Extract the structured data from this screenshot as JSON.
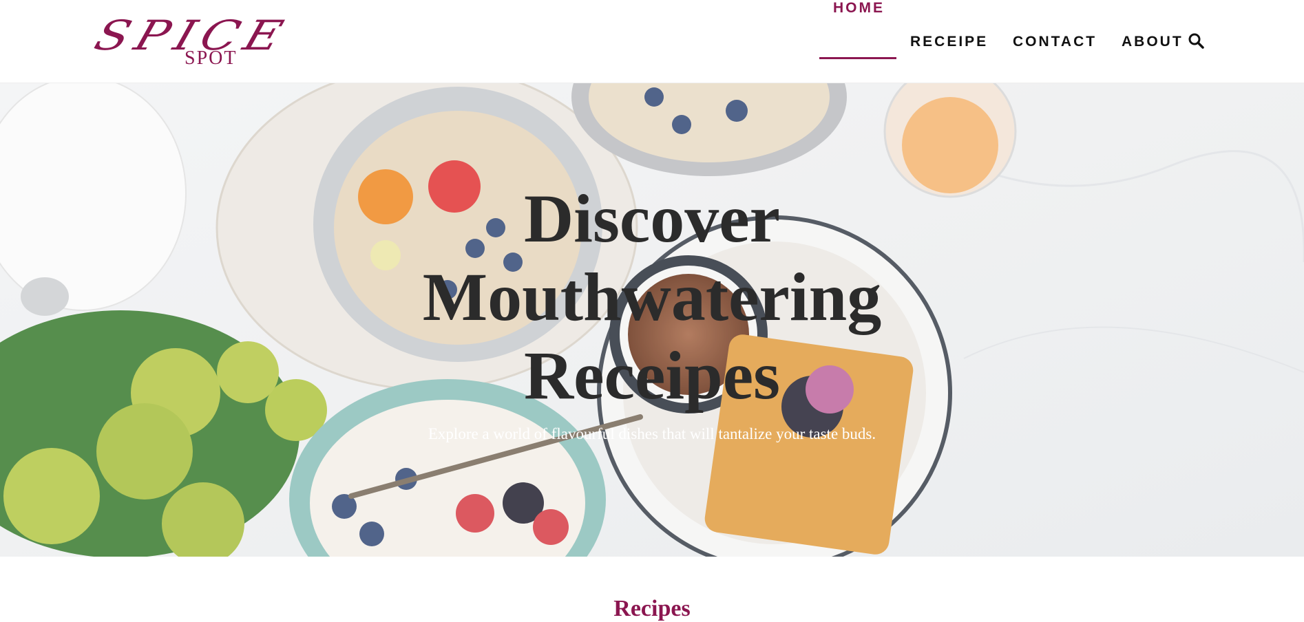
{
  "logo": {
    "script": "SPICE",
    "sub": "SPOT"
  },
  "nav": {
    "home": "HOME",
    "receipe": "RECEIPE",
    "contact": "CONTACT",
    "about": "ABOUT",
    "search_icon": "search-icon"
  },
  "hero": {
    "title_line1": "Discover",
    "title_line2": "Mouthwatering",
    "title_line3": "Receipes",
    "subtitle": "Explore a world of flavourful dishes that will tantalize your taste buds."
  },
  "section": {
    "title": "Recipes"
  },
  "colors": {
    "accent": "#8b1650",
    "text": "#111111",
    "heading": "#2b2b2b"
  }
}
